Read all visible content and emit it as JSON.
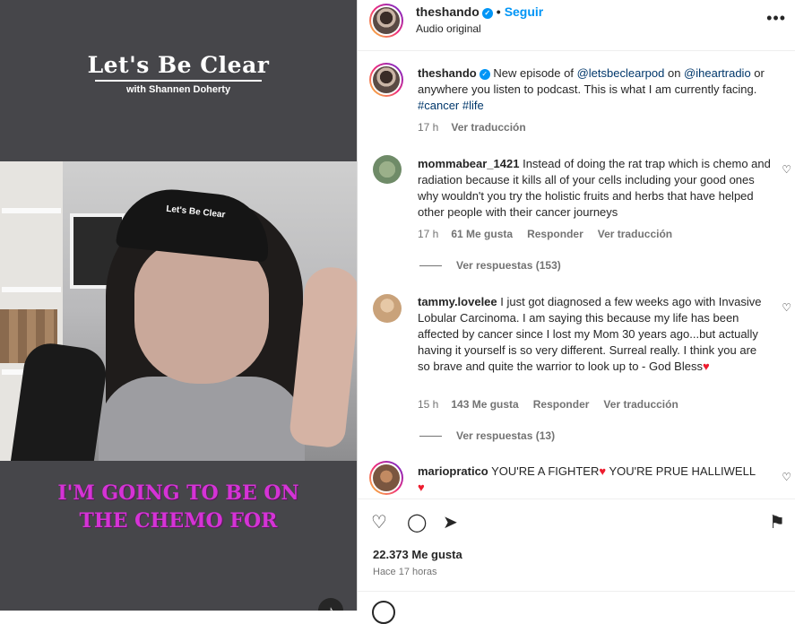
{
  "video": {
    "brand_title": "Let's Be Clear",
    "brand_subtitle": "with Shannen Doherty",
    "cap_text": "Let's Be Clear",
    "caption_line1": "I'M GOING TO BE ON",
    "caption_line2": "THE CHEMO FOR",
    "sound_icon": "speaker-icon"
  },
  "header": {
    "username": "theshando",
    "follow_label": "Seguir",
    "separator": "•",
    "audio_label": "Audio original",
    "more_icon": "•••"
  },
  "post": {
    "username": "theshando",
    "text_a": "New episode of ",
    "mention1": "@letsbeclearpod",
    "text_b": " on ",
    "mention2": "@iheartradio",
    "text_c": " or anywhere you listen to podcast. This is what I am currently facing. ",
    "hashtag1": "#cancer",
    "hashtag2": "#life",
    "time": "17 h",
    "translate": "Ver traducción"
  },
  "comments": [
    {
      "username": "mommabear_1421",
      "text": "Instead of doing the rat trap which is chemo and radiation because it kills all of your cells including your good ones why wouldn't you try the holistic fruits and herbs that have helped other people with their cancer journeys",
      "time": "17 h",
      "likes": "61 Me gusta",
      "reply": "Responder",
      "translate": "Ver traducción",
      "view_replies": "Ver respuestas (153)"
    },
    {
      "username": "tammy.lovelee",
      "text": "I just got diagnosed a few weeks ago with Invasive Lobular Carcinoma. I am saying this because my life has been affected by cancer since I lost my Mom 30 years ago...but actually having it yourself is so very different. Surreal really. I think you are so brave and quite the warrior to look up to - God Bless",
      "emoji": "♥",
      "time": "15 h",
      "likes": "143 Me gusta",
      "reply": "Responder",
      "translate": "Ver traducción",
      "view_replies": "Ver respuestas (13)"
    },
    {
      "username": "mariopratico",
      "text_a": "YOU'RE A FIGHTER",
      "emoji1": "♥",
      "text_b": " YOU'RE PRUE HALLIWELL",
      "emoji2": "♥"
    }
  ],
  "footer": {
    "likes": "22.373 Me gusta",
    "ago": "Hace 17 horas"
  },
  "colors": {
    "accent": "#0095f6",
    "caption": "#d533d6",
    "heart": "#ed1c2e"
  }
}
